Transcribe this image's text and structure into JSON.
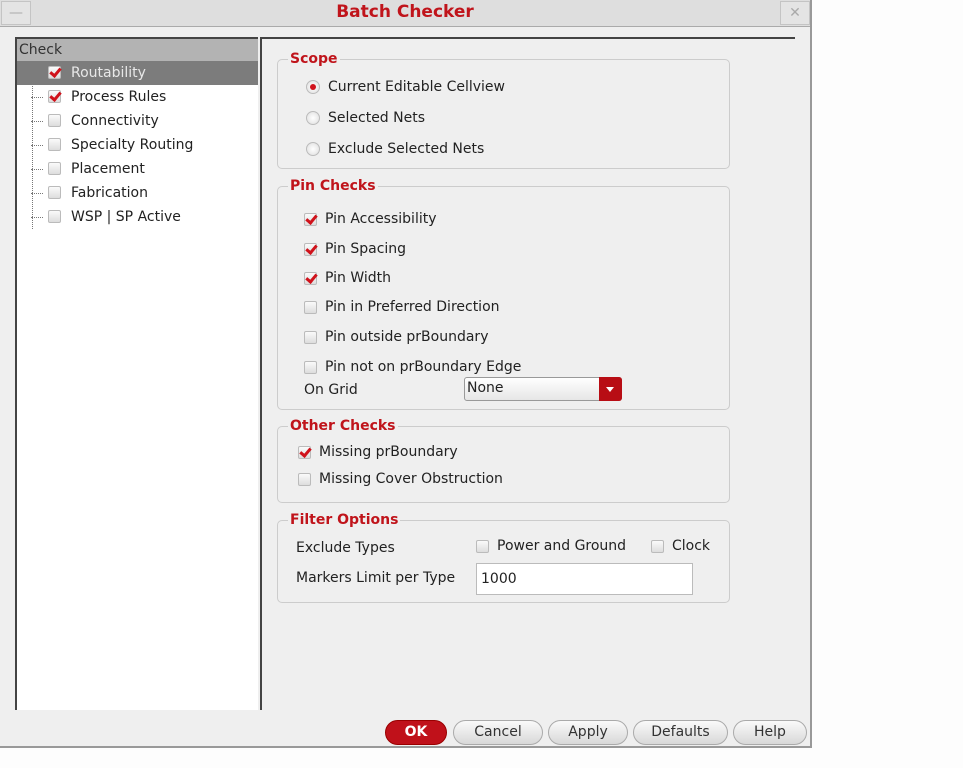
{
  "window": {
    "title": "Batch Checker"
  },
  "tree": {
    "header": "Check",
    "items": [
      {
        "label": "Routability",
        "checked": true,
        "selected": true
      },
      {
        "label": "Process Rules",
        "checked": true
      },
      {
        "label": "Connectivity",
        "checked": false
      },
      {
        "label": "Specialty Routing",
        "checked": false
      },
      {
        "label": "Placement",
        "checked": false
      },
      {
        "label": "Fabrication",
        "checked": false
      },
      {
        "label": "WSP | SP Active",
        "checked": false
      }
    ]
  },
  "scope": {
    "title": "Scope",
    "options": [
      "Current Editable Cellview",
      "Selected Nets",
      "Exclude Selected Nets"
    ],
    "selected": 0
  },
  "pin_checks": {
    "title": "Pin Checks",
    "items": [
      {
        "label": "Pin Accessibility",
        "checked": true
      },
      {
        "label": "Pin Spacing",
        "checked": true
      },
      {
        "label": "Pin Width",
        "checked": true
      },
      {
        "label": "Pin in Preferred Direction",
        "checked": false
      },
      {
        "label": "Pin outside prBoundary",
        "checked": false
      },
      {
        "label": "Pin not on prBoundary Edge",
        "checked": false
      }
    ],
    "on_grid_label": "On Grid",
    "on_grid_value": "None"
  },
  "other_checks": {
    "title": "Other Checks",
    "items": [
      {
        "label": "Missing prBoundary",
        "checked": true
      },
      {
        "label": "Missing Cover Obstruction",
        "checked": false
      }
    ]
  },
  "filter": {
    "title": "Filter Options",
    "exclude_label": "Exclude Types",
    "power_ground": "Power and Ground",
    "clock": "Clock",
    "limit_label": "Markers Limit per Type",
    "limit_value": "1000"
  },
  "buttons": {
    "ok": "OK",
    "cancel": "Cancel",
    "apply": "Apply",
    "defaults": "Defaults",
    "help": "Help"
  },
  "colors": {
    "accent": "#c0141b"
  }
}
